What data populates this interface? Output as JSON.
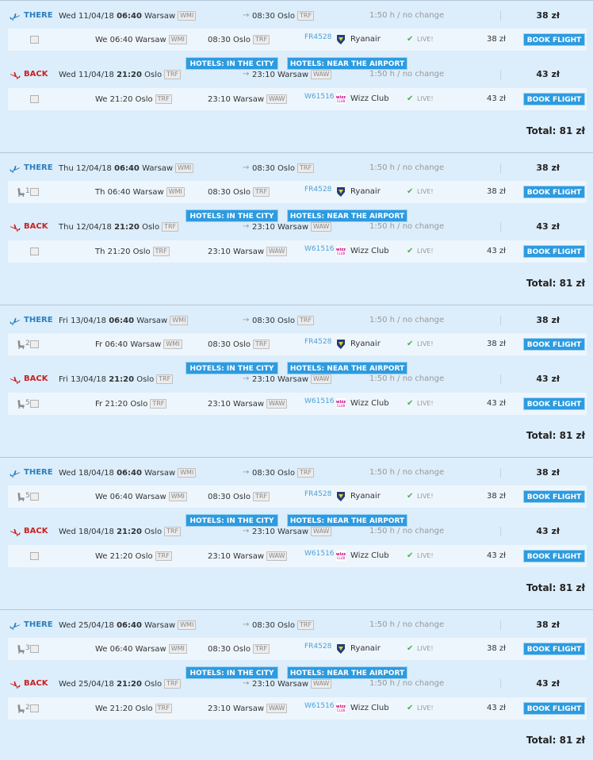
{
  "ui": {
    "there": "THERE",
    "back": "BACK",
    "arrow": "→",
    "total_prefix": "Total:",
    "hotels_city": "HOTELS: IN THE CITY",
    "hotels_airport": "HOTELS: NEAR THE AIRPORT",
    "book": "BOOK FLIGHT",
    "live": "LIVE!",
    "check": "✔",
    "colors": {
      "background": "#dcedfb",
      "button": "#2d9be0",
      "there": "#2a7fbf",
      "back": "#cc2020",
      "flight_number": "#4aa0d8"
    }
  },
  "trips": [
    {
      "total": "81 zł",
      "there": {
        "date": "Wed 11/04/18",
        "dep_time": "06:40",
        "dep_city": "Warsaw",
        "dep_code": "WMI",
        "arr_time": "08:30",
        "arr_city": "Oslo",
        "arr_code": "TRF",
        "duration": "1:50 h / no change",
        "price": "38 zł",
        "detail": {
          "seat_count": "",
          "day": "We",
          "from_time": "06:40",
          "from_city": "Warsaw",
          "from_code": "WMI",
          "to_time": "08:30",
          "to_city": "Oslo",
          "to_code": "TRF",
          "flight": "FR4528",
          "airline": "Ryanair",
          "airline_icon": "ryanair-logo-icon",
          "price": "38 zł"
        }
      },
      "back": {
        "date": "Wed 11/04/18",
        "dep_time": "21:20",
        "dep_city": "Oslo",
        "dep_code": "TRF",
        "arr_time": "23:10",
        "arr_city": "Warsaw",
        "arr_code": "WAW",
        "duration": "1:50 h / no change",
        "price": "43 zł",
        "detail": {
          "seat_count": "",
          "day": "We",
          "from_time": "21:20",
          "from_city": "Oslo",
          "from_code": "TRF",
          "to_time": "23:10",
          "to_city": "Warsaw",
          "to_code": "WAW",
          "flight": "W61516",
          "airline": "Wizz Club",
          "airline_icon": "wizz-logo-icon",
          "price": "43 zł"
        }
      }
    },
    {
      "total": "81 zł",
      "there": {
        "date": "Thu 12/04/18",
        "dep_time": "06:40",
        "dep_city": "Warsaw",
        "dep_code": "WMI",
        "arr_time": "08:30",
        "arr_city": "Oslo",
        "arr_code": "TRF",
        "duration": "1:50 h / no change",
        "price": "38 zł",
        "detail": {
          "seat_count": "1",
          "day": "Th",
          "from_time": "06:40",
          "from_city": "Warsaw",
          "from_code": "WMI",
          "to_time": "08:30",
          "to_city": "Oslo",
          "to_code": "TRF",
          "flight": "FR4528",
          "airline": "Ryanair",
          "airline_icon": "ryanair-logo-icon",
          "price": "38 zł"
        }
      },
      "back": {
        "date": "Thu 12/04/18",
        "dep_time": "21:20",
        "dep_city": "Oslo",
        "dep_code": "TRF",
        "arr_time": "23:10",
        "arr_city": "Warsaw",
        "arr_code": "WAW",
        "duration": "1:50 h / no change",
        "price": "43 zł",
        "detail": {
          "seat_count": "",
          "day": "Th",
          "from_time": "21:20",
          "from_city": "Oslo",
          "from_code": "TRF",
          "to_time": "23:10",
          "to_city": "Warsaw",
          "to_code": "WAW",
          "flight": "W61516",
          "airline": "Wizz Club",
          "airline_icon": "wizz-logo-icon",
          "price": "43 zł"
        }
      }
    },
    {
      "total": "81 zł",
      "there": {
        "date": "Fri 13/04/18",
        "dep_time": "06:40",
        "dep_city": "Warsaw",
        "dep_code": "WMI",
        "arr_time": "08:30",
        "arr_city": "Oslo",
        "arr_code": "TRF",
        "duration": "1:50 h / no change",
        "price": "38 zł",
        "detail": {
          "seat_count": "2",
          "day": "Fr",
          "from_time": "06:40",
          "from_city": "Warsaw",
          "from_code": "WMI",
          "to_time": "08:30",
          "to_city": "Oslo",
          "to_code": "TRF",
          "flight": "FR4528",
          "airline": "Ryanair",
          "airline_icon": "ryanair-logo-icon",
          "price": "38 zł"
        }
      },
      "back": {
        "date": "Fri 13/04/18",
        "dep_time": "21:20",
        "dep_city": "Oslo",
        "dep_code": "TRF",
        "arr_time": "23:10",
        "arr_city": "Warsaw",
        "arr_code": "WAW",
        "duration": "1:50 h / no change",
        "price": "43 zł",
        "detail": {
          "seat_count": "5",
          "day": "Fr",
          "from_time": "21:20",
          "from_city": "Oslo",
          "from_code": "TRF",
          "to_time": "23:10",
          "to_city": "Warsaw",
          "to_code": "WAW",
          "flight": "W61516",
          "airline": "Wizz Club",
          "airline_icon": "wizz-logo-icon",
          "price": "43 zł"
        }
      }
    },
    {
      "total": "81 zł",
      "there": {
        "date": "Wed 18/04/18",
        "dep_time": "06:40",
        "dep_city": "Warsaw",
        "dep_code": "WMI",
        "arr_time": "08:30",
        "arr_city": "Oslo",
        "arr_code": "TRF",
        "duration": "1:50 h / no change",
        "price": "38 zł",
        "detail": {
          "seat_count": "5",
          "day": "We",
          "from_time": "06:40",
          "from_city": "Warsaw",
          "from_code": "WMI",
          "to_time": "08:30",
          "to_city": "Oslo",
          "to_code": "TRF",
          "flight": "FR4528",
          "airline": "Ryanair",
          "airline_icon": "ryanair-logo-icon",
          "price": "38 zł"
        }
      },
      "back": {
        "date": "Wed 18/04/18",
        "dep_time": "21:20",
        "dep_city": "Oslo",
        "dep_code": "TRF",
        "arr_time": "23:10",
        "arr_city": "Warsaw",
        "arr_code": "WAW",
        "duration": "1:50 h / no change",
        "price": "43 zł",
        "detail": {
          "seat_count": "",
          "day": "We",
          "from_time": "21:20",
          "from_city": "Oslo",
          "from_code": "TRF",
          "to_time": "23:10",
          "to_city": "Warsaw",
          "to_code": "WAW",
          "flight": "W61516",
          "airline": "Wizz Club",
          "airline_icon": "wizz-logo-icon",
          "price": "43 zł"
        }
      }
    },
    {
      "total": "81 zł",
      "there": {
        "date": "Wed 25/04/18",
        "dep_time": "06:40",
        "dep_city": "Warsaw",
        "dep_code": "WMI",
        "arr_time": "08:30",
        "arr_city": "Oslo",
        "arr_code": "TRF",
        "duration": "1:50 h / no change",
        "price": "38 zł",
        "detail": {
          "seat_count": "3",
          "day": "We",
          "from_time": "06:40",
          "from_city": "Warsaw",
          "from_code": "WMI",
          "to_time": "08:30",
          "to_city": "Oslo",
          "to_code": "TRF",
          "flight": "FR4528",
          "airline": "Ryanair",
          "airline_icon": "ryanair-logo-icon",
          "price": "38 zł"
        }
      },
      "back": {
        "date": "Wed 25/04/18",
        "dep_time": "21:20",
        "dep_city": "Oslo",
        "dep_code": "TRF",
        "arr_time": "23:10",
        "arr_city": "Warsaw",
        "arr_code": "WAW",
        "duration": "1:50 h / no change",
        "price": "43 zł",
        "detail": {
          "seat_count": "2",
          "day": "We",
          "from_time": "21:20",
          "from_city": "Oslo",
          "from_code": "TRF",
          "to_time": "23:10",
          "to_city": "Warsaw",
          "to_code": "WAW",
          "flight": "W61516",
          "airline": "Wizz Club",
          "airline_icon": "wizz-logo-icon",
          "price": "43 zł"
        }
      }
    }
  ]
}
